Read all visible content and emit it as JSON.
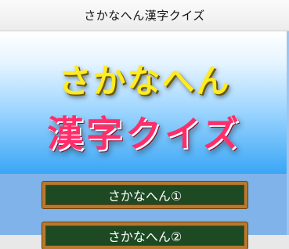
{
  "header": {
    "title": "さかなへん漢字クイズ"
  },
  "hero": {
    "line1": "さかなへん",
    "line2": "漢字クイズ"
  },
  "menu": {
    "items": [
      {
        "label": "さかなへん①"
      },
      {
        "label": "さかなへん②"
      }
    ]
  },
  "colors": {
    "title_yellow": "#ffeb22",
    "title_pink": "#ff2e6a",
    "button_green": "#1d4a23",
    "button_frame": "#b77a2d",
    "lower_bg": "#7fb3ea"
  }
}
